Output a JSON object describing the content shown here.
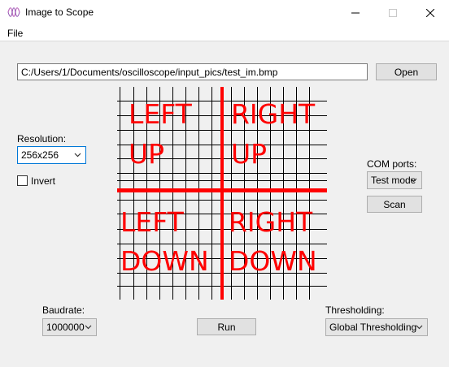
{
  "window": {
    "title": "Image to Scope"
  },
  "menu": {
    "file": "File"
  },
  "file_path": {
    "value": "C:/Users/1/Documents/oscilloscope/input_pics/test_im.bmp"
  },
  "buttons": {
    "open": "Open",
    "scan": "Scan",
    "run": "Run"
  },
  "resolution": {
    "label": "Resolution:",
    "value": "256x256"
  },
  "invert": {
    "label": "Invert",
    "checked": false
  },
  "com_ports": {
    "label": "COM ports:",
    "value": "Test mode"
  },
  "baudrate": {
    "label": "Baudrate:",
    "value": "1000000"
  },
  "thresholding": {
    "label": "Thresholding:",
    "value": "Global Thresholding"
  },
  "preview": {
    "top_left": [
      "LEFT",
      "UP"
    ],
    "top_right": [
      "RIGHT",
      "UP"
    ],
    "bottom_left": [
      "LEFT",
      "DOWN"
    ],
    "bottom_right": [
      "RIGHT",
      "DOWN"
    ],
    "color": "#ff0000"
  }
}
